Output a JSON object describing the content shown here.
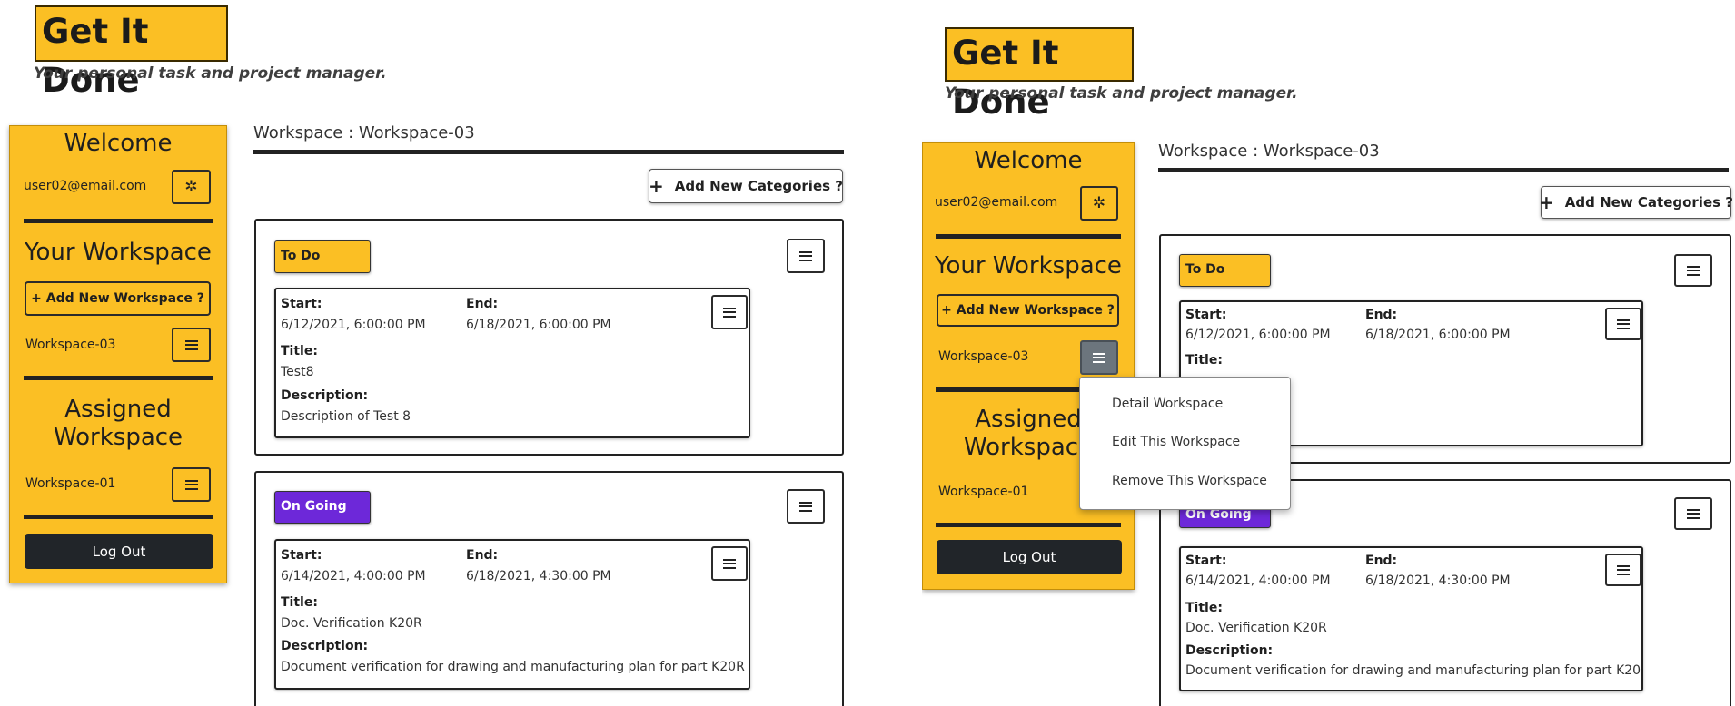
{
  "app": {
    "title": "Get It Done",
    "tagline": "Your personal task and project manager."
  },
  "sidebar": {
    "welcome": "Welcome",
    "user_email": "user02@email.com",
    "settings_icon": "gear-icon",
    "your_workspace": "Your Workspace",
    "add_workspace_label": "+ Add New Workspace ?",
    "own_workspace": "Workspace-03",
    "assigned_heading_1": "Assigned",
    "assigned_heading_2": "Workspace",
    "assigned_workspace": "Workspace-01",
    "logout": "Log Out"
  },
  "workspace": {
    "title": "Workspace : Workspace-03",
    "add_category_label": "Add New Categories ?",
    "categories": [
      {
        "name": "To Do",
        "color": "#fbbf24",
        "task": {
          "start_label": "Start:",
          "start": "6/12/2021, 6:00:00 PM",
          "end_label": "End:",
          "end": "6/18/2021, 6:00:00 PM",
          "title_label": "Title:",
          "title": "Test8",
          "desc_label": "Description:",
          "desc": "Description of Test 8"
        }
      },
      {
        "name": "On Going",
        "color": "#6d28d9",
        "task": {
          "start_label": "Start:",
          "start": "6/14/2021, 4:00:00 PM",
          "end_label": "End:",
          "end": "6/18/2021, 4:30:00 PM",
          "title_label": "Title:",
          "title": "Doc. Verification K20R",
          "desc_label": "Description:",
          "desc": "Document verification for drawing and manufacturing plan for part K20R"
        }
      }
    ],
    "right_partial_desc": "t 8"
  },
  "dropdown": {
    "items": [
      "Detail Workspace",
      "Edit This Workspace",
      "Remove This Workspace"
    ]
  },
  "colors": {
    "brand_yellow": "#fbbf24",
    "ongoing_purple": "#6d28d9",
    "dark": "#212529"
  }
}
